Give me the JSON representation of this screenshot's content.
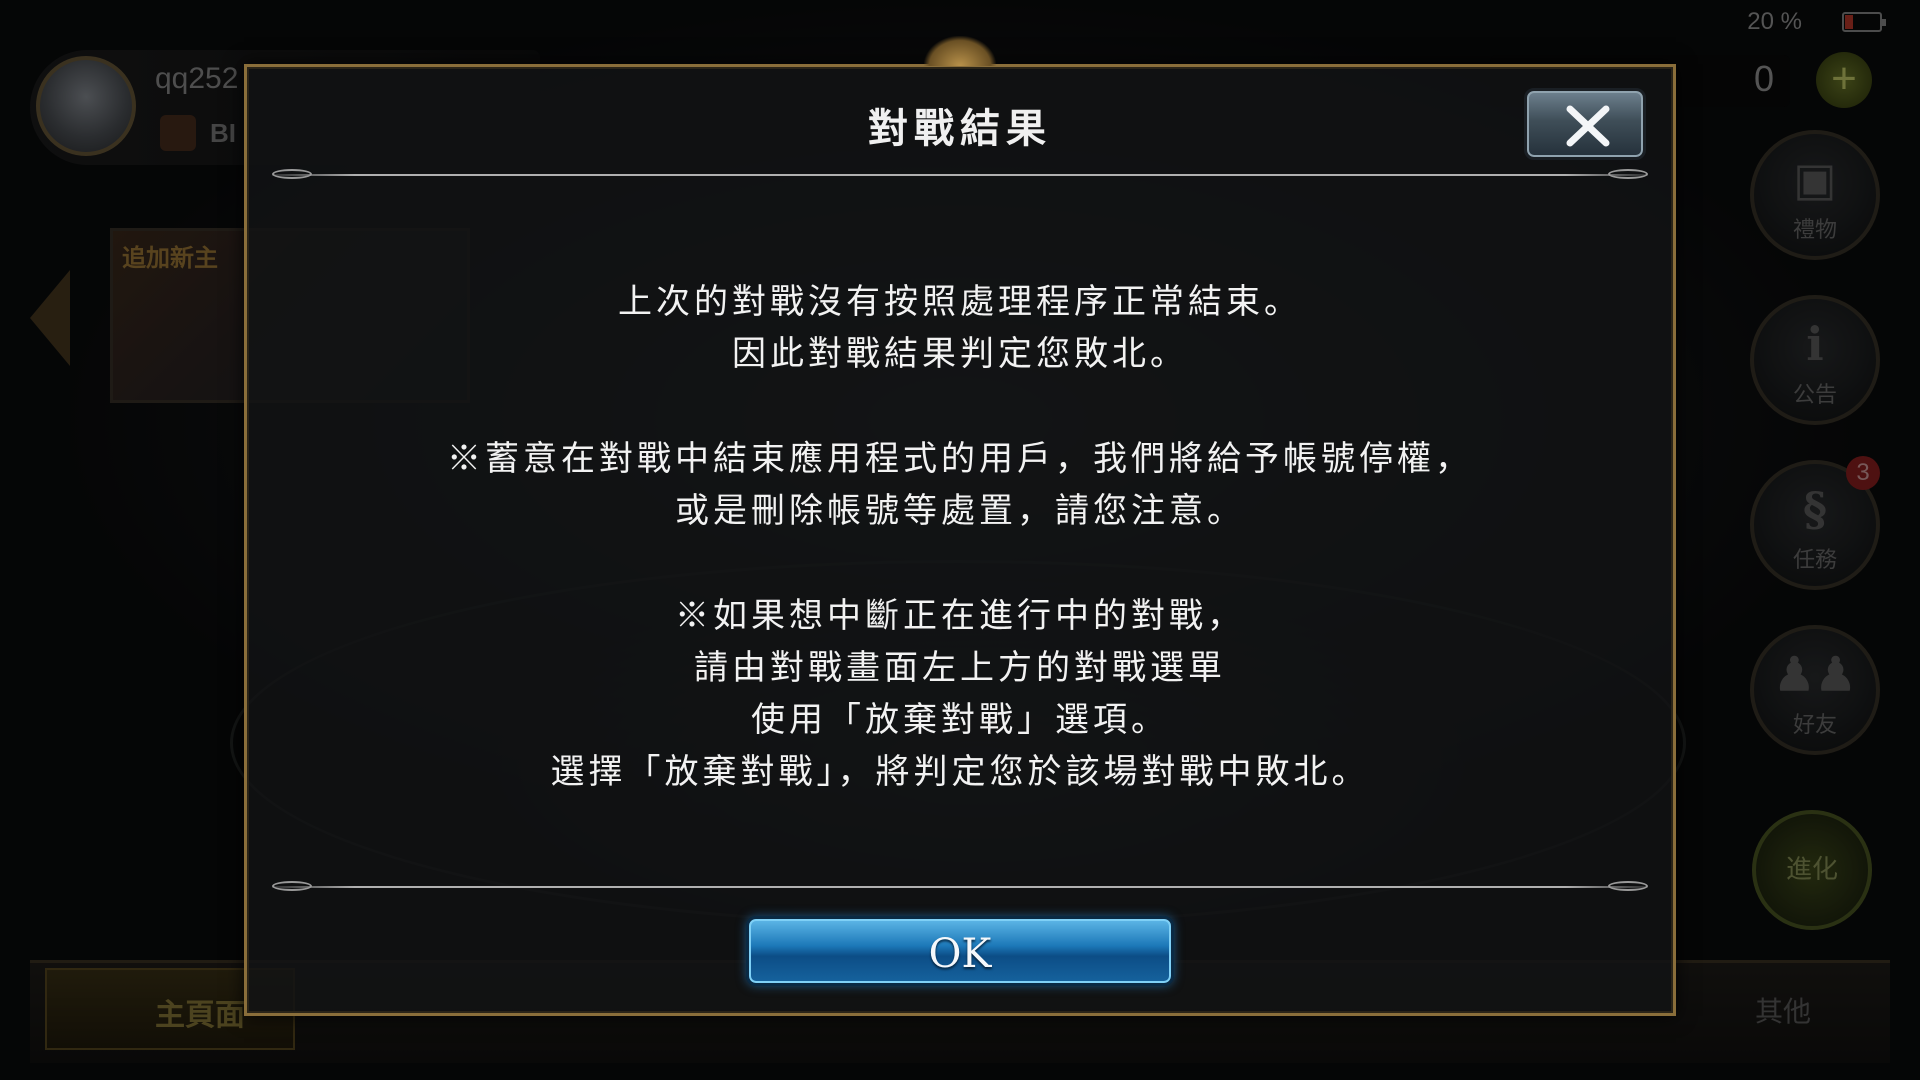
{
  "status_bar": {
    "battery_text": "20 %"
  },
  "player": {
    "name": "qq252",
    "rank": "BI"
  },
  "currency": {
    "value": "0",
    "add_symbol": "+"
  },
  "banner": {
    "text": "追加新主"
  },
  "side_menu": {
    "gift_label": "禮物",
    "notice_label": "公告",
    "notice_icon": "i",
    "mission_label": "任務",
    "mission_badge": "3",
    "friends_label": "好友",
    "evolve_label": "進化"
  },
  "bottom_nav": {
    "home_label": "主頁面",
    "other_label": "其他"
  },
  "dialog": {
    "title": "對戰結果",
    "message_lines": [
      "上次的對戰沒有按照處理程序正常結束。",
      "因此對戰結果判定您敗北。",
      "※蓄意在對戰中結束應用程式的用戶，我們將給予帳號停權，",
      "或是刪除帳號等處置，請您注意。",
      "※如果想中斷正在進行中的對戰，",
      "請由對戰畫面左上方的對戰選單",
      "使用「放棄對戰」選項。",
      "選擇「放棄對戰」，將判定您於該場對戰中敗北。"
    ],
    "ok_label": "OK"
  },
  "colors": {
    "dialog_border": "#8a6e3a",
    "ok_button": "#1c78b8",
    "close_button": "#3f4e58",
    "text": "#f2f2f2"
  }
}
